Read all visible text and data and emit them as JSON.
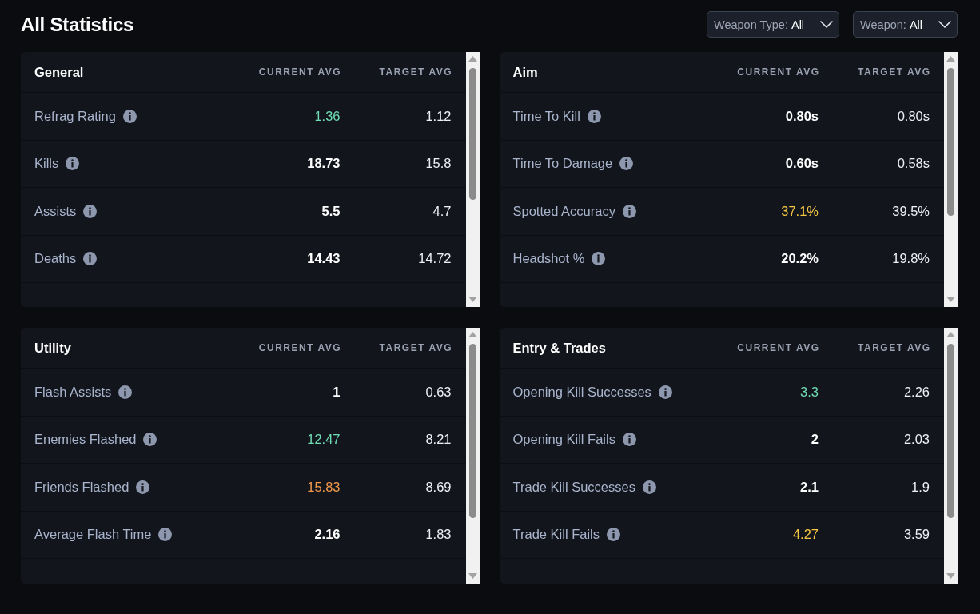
{
  "page": {
    "title": "All Statistics"
  },
  "filters": [
    {
      "label": "Weapon Type:",
      "value": "All"
    },
    {
      "label": "Weapon:",
      "value": "All"
    }
  ],
  "panels": [
    {
      "title": "General",
      "columns": [
        "CURRENT AVG",
        "TARGET AVG"
      ],
      "rows": [
        {
          "name": "Refrag Rating",
          "current": "1.36",
          "target": "1.12",
          "color": "#70dcb3"
        },
        {
          "name": "Kills",
          "current": "18.73",
          "target": "15.8"
        },
        {
          "name": "Assists",
          "current": "5.5",
          "target": "4.7"
        },
        {
          "name": "Deaths",
          "current": "14.43",
          "target": "14.72"
        }
      ]
    },
    {
      "title": "Aim",
      "columns": [
        "CURRENT AVG",
        "TARGET AVG"
      ],
      "rows": [
        {
          "name": "Time To Kill",
          "current": "0.80s",
          "target": "0.80s"
        },
        {
          "name": "Time To Damage",
          "current": "0.60s",
          "target": "0.58s"
        },
        {
          "name": "Spotted Accuracy",
          "current": "37.1%",
          "target": "39.5%",
          "color": "#f5c644"
        },
        {
          "name": "Headshot %",
          "current": "20.2%",
          "target": "19.8%"
        }
      ]
    },
    {
      "title": "Utility",
      "columns": [
        "CURRENT AVG",
        "TARGET AVG"
      ],
      "rows": [
        {
          "name": "Flash Assists",
          "current": "1",
          "target": "0.63"
        },
        {
          "name": "Enemies Flashed",
          "current": "12.47",
          "target": "8.21",
          "color": "#70dcb3"
        },
        {
          "name": "Friends Flashed",
          "current": "15.83",
          "target": "8.69",
          "color": "#f09a4c"
        },
        {
          "name": "Average Flash Time",
          "current": "2.16",
          "target": "1.83"
        }
      ]
    },
    {
      "title": "Entry & Trades",
      "columns": [
        "CURRENT AVG",
        "TARGET AVG"
      ],
      "rows": [
        {
          "name": "Opening Kill Successes",
          "current": "3.3",
          "target": "2.26",
          "color": "#70dcb3"
        },
        {
          "name": "Opening Kill Fails",
          "current": "2",
          "target": "2.03"
        },
        {
          "name": "Trade Kill Successes",
          "current": "2.1",
          "target": "1.9"
        },
        {
          "name": "Trade Kill Fails",
          "current": "4.27",
          "target": "3.59",
          "color": "#f5c644"
        }
      ]
    }
  ]
}
